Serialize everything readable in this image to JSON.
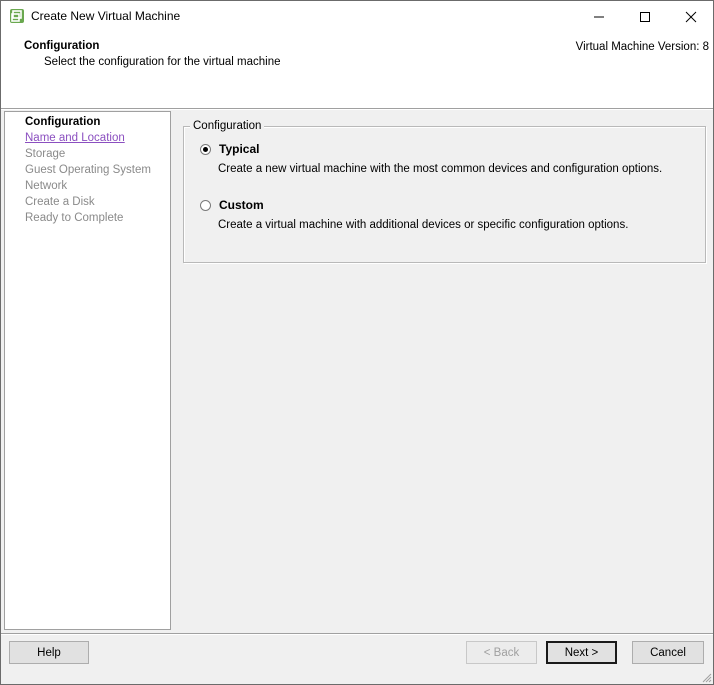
{
  "window": {
    "title": "Create New Virtual Machine",
    "icon": "vmware-icon",
    "controls": [
      "minimize-icon",
      "maximize-icon",
      "close-icon"
    ]
  },
  "header": {
    "title": "Configuration",
    "subtitle": "Select the configuration for the virtual machine",
    "version": "Virtual Machine Version: 8"
  },
  "steps": [
    {
      "label": "Configuration",
      "state": "current"
    },
    {
      "label": "Name and Location",
      "state": "link"
    },
    {
      "label": "Storage",
      "state": "disabled"
    },
    {
      "label": "Guest Operating System",
      "state": "disabled"
    },
    {
      "label": "Network",
      "state": "disabled"
    },
    {
      "label": "Create a Disk",
      "state": "disabled"
    },
    {
      "label": "Ready to Complete",
      "state": "disabled"
    }
  ],
  "config": {
    "group_title": "Configuration",
    "options": [
      {
        "label": "Typical",
        "description": "Create a new virtual machine with the most common devices and configuration options.",
        "selected": true
      },
      {
        "label": "Custom",
        "description": "Create a virtual machine with additional devices or specific configuration options.",
        "selected": false
      }
    ]
  },
  "buttons": {
    "help": "Help",
    "back": "< Back",
    "next": "Next >",
    "cancel": "Cancel"
  },
  "colors": {
    "link": "#8b4fc0",
    "disabled_text": "#8a8a8a",
    "background": "#f0f0f0"
  }
}
